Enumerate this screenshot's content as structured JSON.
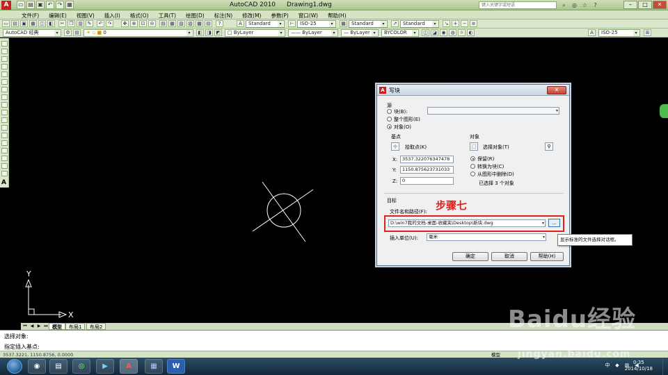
{
  "titlebar": {
    "app_name": "AutoCAD 2010",
    "doc_name": "Drawing1.dwg",
    "search_placeholder": "键入关键字或短语"
  },
  "menu": [
    "文件(F)",
    "编辑(E)",
    "视图(V)",
    "插入(I)",
    "格式(O)",
    "工具(T)",
    "绘图(D)",
    "标注(N)",
    "修改(M)",
    "参数(P)",
    "窗口(W)",
    "帮助(H)"
  ],
  "toolbar1": {
    "text_style": "Standard",
    "dim_style": "ISO-25",
    "table_style": "Standard",
    "multileader_style": "Standard"
  },
  "toolbar2": {
    "workspace": "AutoCAD 经典",
    "layer": "0",
    "color": "ByLayer",
    "linetype": "ByLayer",
    "lineweight": "ByLayer",
    "plotstyle": "BYCOLOR",
    "annotation_scale": "ISO-25"
  },
  "ucs": {
    "y_label": "Y",
    "x_label": "X"
  },
  "layout_tabs": [
    "模型",
    "布局1",
    "布局2"
  ],
  "command": {
    "line1": "选择对象:",
    "line2": "指定插入基点:"
  },
  "status": {
    "coords": "3537.3221, 1150.8756, 0.0000",
    "model": "模型"
  },
  "clock": {
    "time": "0:35",
    "date": "2014/10/18"
  },
  "dialog": {
    "title": "写块",
    "source_label": "源",
    "radio_block": "块(B):",
    "radio_entire": "整个图形(E)",
    "radio_objects": "对象(O)",
    "basepoint_label": "基点",
    "pick_point": "拾取点(K)",
    "x_label": "X:",
    "x_value": "3537.322076347478",
    "y_label": "Y:",
    "y_value": "1150.875623731033",
    "z_label": "Z:",
    "z_value": "0",
    "objects_label": "对象",
    "select_objects": "选择对象(T)",
    "retain": "保留(R)",
    "convert": "转换为块(C)",
    "delete": "从图形中删除(D)",
    "selected_count": "已选择 3 个对象",
    "target_label": "目标",
    "filename_label": "文件名和路径(F):",
    "filename_value": "D:\\win7我的文档-桌面-收藏夹\\Desktop\\新块.dwg",
    "browse_label": "...",
    "units_label": "插入单位(U):",
    "units_value": "毫米",
    "ok": "确定",
    "cancel": "取消",
    "help": "帮助(H)"
  },
  "annotation": {
    "step": "步骤七"
  },
  "tooltip": "显示标准的文件选择对话框。",
  "watermark": {
    "brand": "Baidu经验",
    "url": "jingyan.baidu.com"
  }
}
